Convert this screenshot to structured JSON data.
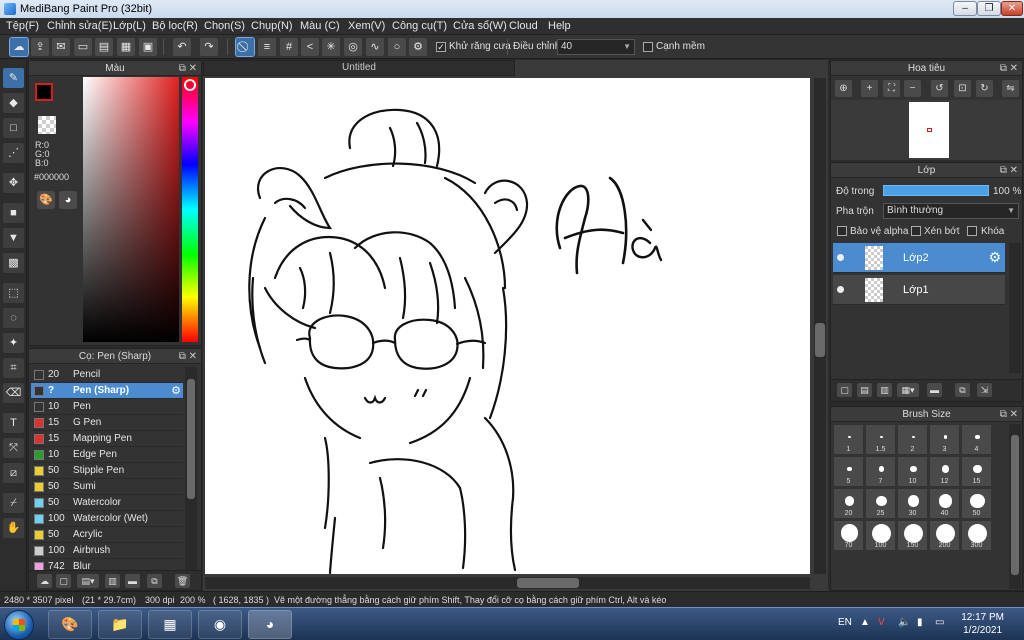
{
  "window": {
    "title": "MediBang Paint Pro (32bit)"
  },
  "menu": [
    "Tệp(F)",
    "Chỉnh sửa(E)",
    "Lớp(L)",
    "Bộ lọc(R)",
    "Chọn(S)",
    "Chụp(N)",
    "Màu (C)",
    "Xem(V)",
    "Công cụ(T)",
    "Cửa sổ(W)",
    "Cloud",
    "Help"
  ],
  "toolbar": {
    "antialias_label": "Khử răng cưa",
    "adjust_label": "Điều chỉnh",
    "adjust_value": "40",
    "soft_edge_label": "Cạnh mềm"
  },
  "color_panel": {
    "title": "Màu",
    "r": "R:0",
    "g": "G:0",
    "b": "B:0",
    "hex": "#000000",
    "accent": "#d21e1e"
  },
  "document": {
    "tab": "Untitled"
  },
  "brush_panel": {
    "title": "Cọ: Pen (Sharp)",
    "items": [
      {
        "size": "20",
        "name": "Pencil",
        "color": "#333333"
      },
      {
        "size": "?",
        "name": "Pen (Sharp)",
        "color": "#333333"
      },
      {
        "size": "10",
        "name": "Pen",
        "color": "#333333"
      },
      {
        "size": "15",
        "name": "G Pen",
        "color": "#e03030"
      },
      {
        "size": "15",
        "name": "Mapping Pen",
        "color": "#e03030"
      },
      {
        "size": "10",
        "name": "Edge Pen",
        "color": "#2aa02a"
      },
      {
        "size": "50",
        "name": "Stipple Pen",
        "color": "#e8d030"
      },
      {
        "size": "50",
        "name": "Sumi",
        "color": "#e8d030"
      },
      {
        "size": "50",
        "name": "Watercolor",
        "color": "#6fd0f0"
      },
      {
        "size": "100",
        "name": "Watercolor (Wet)",
        "color": "#6fd0f0"
      },
      {
        "size": "50",
        "name": "Acrylic",
        "color": "#e8d030"
      },
      {
        "size": "100",
        "name": "Airbrush",
        "color": "#cccccc"
      },
      {
        "size": "742",
        "name": "Blur",
        "color": "#f0a0e0"
      }
    ]
  },
  "navigator": {
    "title": "Hoa tiêu"
  },
  "layer_panel": {
    "title": "Lớp",
    "opacity_label": "Độ trong",
    "opacity_value": "100 %",
    "opacity_fraction": 1.0,
    "blend_label": "Pha trộn",
    "blend_value": "Bình thường",
    "protect_alpha": "Bảo vệ alpha",
    "clipping": "Xén bớt",
    "lock": "Khóa",
    "layers": [
      {
        "name": "Lớp2",
        "selected": true
      },
      {
        "name": "Lớp1",
        "selected": false
      }
    ]
  },
  "brush_size_panel": {
    "title": "Brush Size",
    "sizes": [
      "1",
      "1.5",
      "2",
      "3",
      "4",
      "5",
      "7",
      "10",
      "12",
      "15",
      "20",
      "25",
      "30",
      "40",
      "50",
      "70",
      "100",
      "150",
      "200",
      "300"
    ]
  },
  "status": {
    "dimensions": "2480 * 3507 pixel",
    "physical": "(21 * 29.7cm)",
    "dpi": "300 dpi",
    "zoom": "200 %",
    "cursor": "( 1628, 1835 )",
    "hint": "Vẽ một đường thẳng bằng cách giữ phím Shift, Thay đổi cỡ cọ bằng cách giữ phím Ctrl, Alt và kéo"
  },
  "taskbar": {
    "lang": "EN",
    "time": "12:17 PM",
    "date": "1/2/2021"
  }
}
